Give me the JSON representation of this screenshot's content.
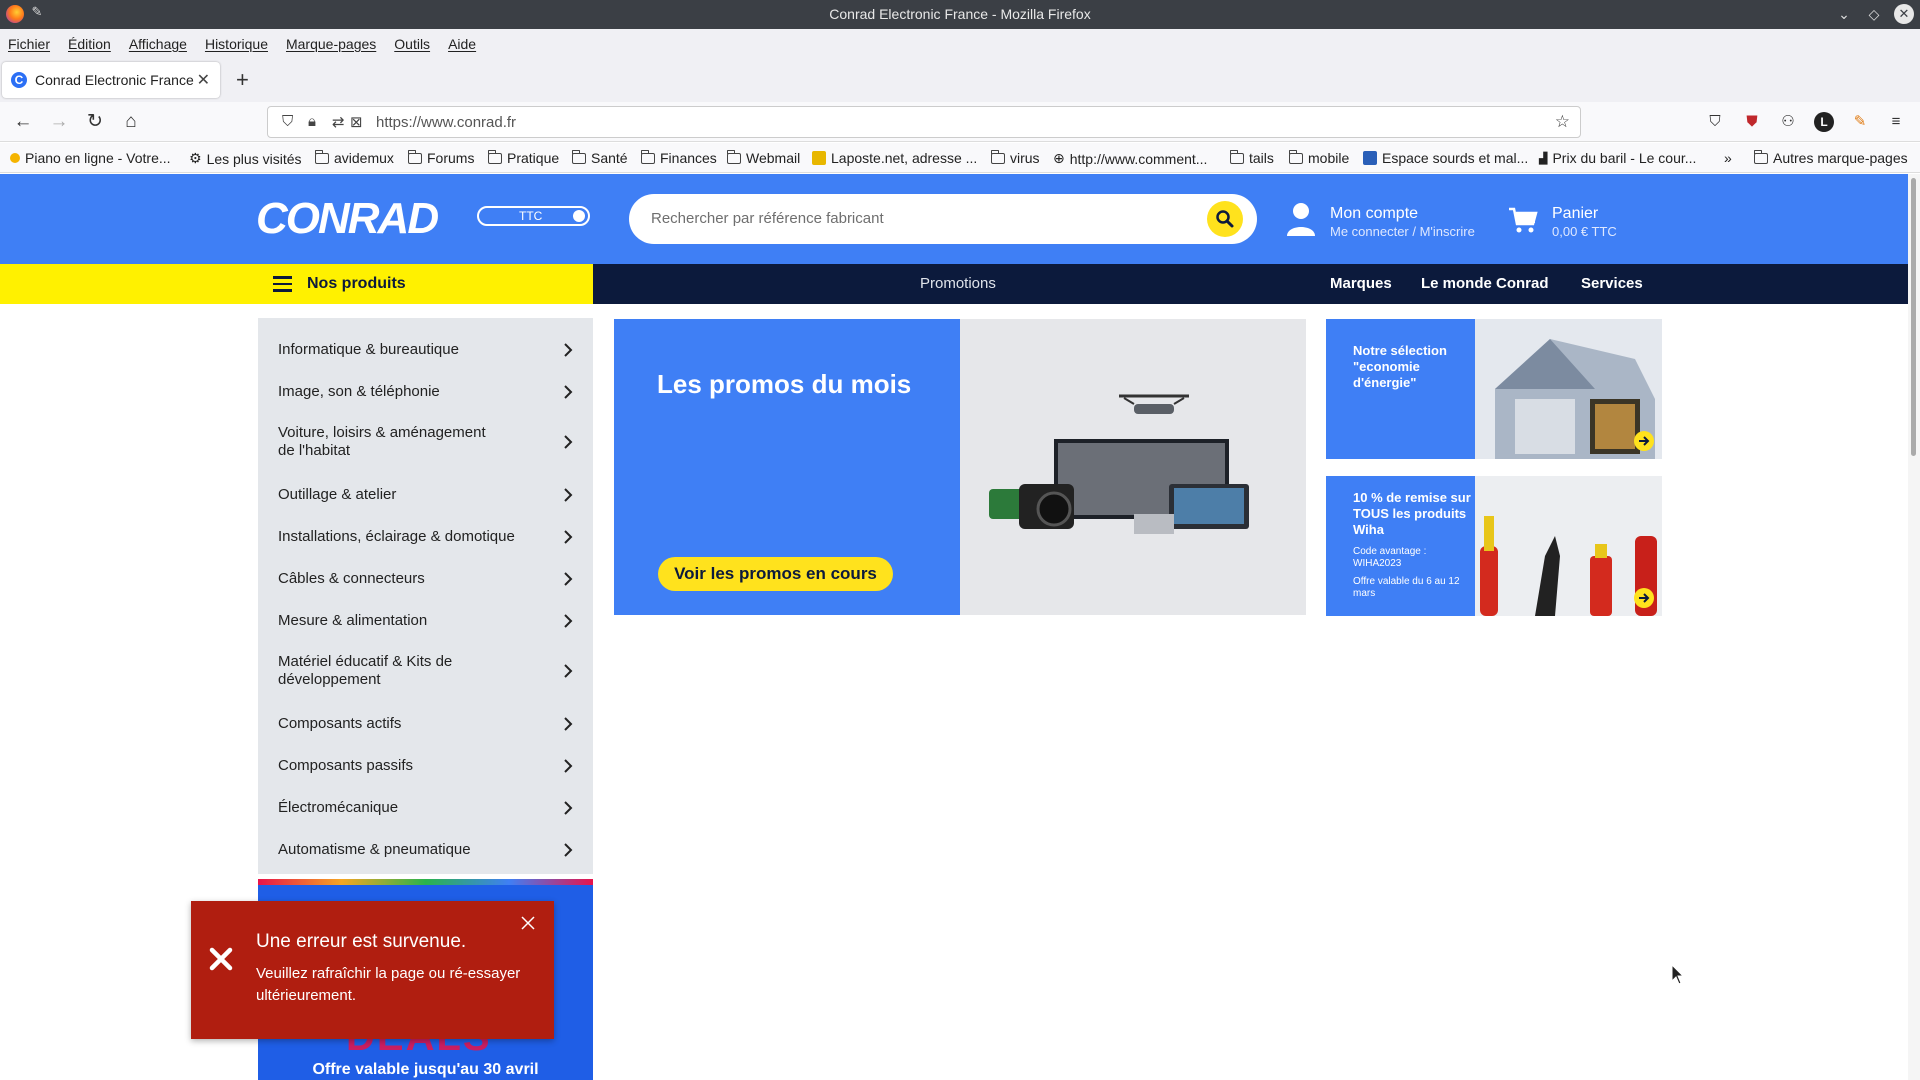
{
  "window": {
    "title": "Conrad Electronic France - Mozilla Firefox"
  },
  "menubar": [
    "Fichier",
    "Édition",
    "Affichage",
    "Historique",
    "Marque-pages",
    "Outils",
    "Aide"
  ],
  "tab": {
    "title": "Conrad Electronic France",
    "new_tab": "+"
  },
  "url": {
    "value": "https://www.conrad.fr"
  },
  "bookmarks": [
    {
      "label": "Piano en ligne - Votre...",
      "icon": "piano-icon"
    },
    {
      "label": "Les plus visités",
      "icon": "gear-icon"
    },
    {
      "label": "avidemux",
      "icon": "folder-icon"
    },
    {
      "label": "Forums",
      "icon": "folder-icon"
    },
    {
      "label": "Pratique",
      "icon": "folder-icon"
    },
    {
      "label": "Santé",
      "icon": "folder-icon"
    },
    {
      "label": "Finances",
      "icon": "folder-icon"
    },
    {
      "label": "Webmail",
      "icon": "folder-icon"
    },
    {
      "label": "Laposte.net, adresse ...",
      "icon": "mail-icon"
    },
    {
      "label": "virus",
      "icon": "folder-icon"
    },
    {
      "label": "http://www.comment...",
      "icon": "globe-icon"
    },
    {
      "label": "tails",
      "icon": "folder-icon"
    },
    {
      "label": "mobile",
      "icon": "folder-icon"
    },
    {
      "label": "Espace sourds et mal...",
      "icon": "site-icon"
    },
    {
      "label": "Prix du baril - Le cour...",
      "icon": "chart-icon"
    },
    {
      "label": "Autres marque-pages",
      "icon": "folder-icon"
    }
  ],
  "site": {
    "logo": "CONRAD",
    "price_toggle": "TTC",
    "search_placeholder": "Rechercher par référence fabricant",
    "account": {
      "title": "Mon compte",
      "subtitle": "Me connecter / M'inscrire"
    },
    "cart": {
      "title": "Panier",
      "subtitle": "0,00 € TTC"
    },
    "nav": {
      "products": "Nos produits",
      "promotions": "Promotions",
      "brands": "Marques",
      "world": "Le monde Conrad",
      "services": "Services"
    },
    "categories": [
      "Informatique & bureautique",
      "Image, son & téléphonie",
      "Voiture, loisirs & aménagement de l'habitat",
      "Outillage & atelier",
      "Installations, éclairage & domotique",
      "Câbles & connecteurs",
      "Mesure & alimentation",
      "Matériel éducatif & Kits de développement",
      "Composants actifs",
      "Composants passifs",
      "Électromécanique",
      "Automatisme & pneumatique"
    ],
    "promo": {
      "title": "Les promos du mois",
      "cta": "Voir les promos en cours"
    },
    "banner_energy": {
      "text": "Notre sélection \"economie d'énergie\""
    },
    "banner_wiha": {
      "text": "10 % de remise sur TOUS les produits Wiha",
      "code": "Code avantage : WIHA2023",
      "validity": "Offre valable du 6 au 12 mars"
    },
    "deals": {
      "big": "DEALS",
      "offer": "Offre valable jusqu'au 30 avril"
    },
    "error": {
      "title": "Une erreur est survenue.",
      "message": "Veuillez rafraîchir la page ou ré-essayer ultérieurement."
    }
  },
  "colors": {
    "brand_blue": "#3f7ff5",
    "nav_dark": "#0c1a3c",
    "accent_yellow": "#ffe21d",
    "error_red": "#b01e10"
  }
}
